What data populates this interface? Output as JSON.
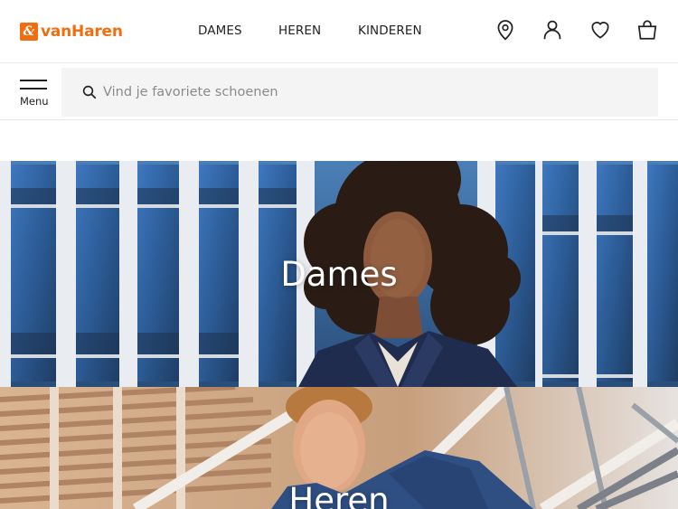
{
  "header": {
    "logo_mark": "&",
    "logo_text": "vanHaren",
    "nav": [
      {
        "label": "DAMES"
      },
      {
        "label": "HEREN"
      },
      {
        "label": "KINDEREN"
      }
    ],
    "icons": [
      "store-locator-icon",
      "account-icon",
      "wishlist-heart-icon",
      "shopping-bag-icon"
    ]
  },
  "search": {
    "menu_label": "Menu",
    "placeholder": "Vind je favoriete schoenen"
  },
  "categories": [
    {
      "title": "Dames"
    },
    {
      "title": "Heren"
    }
  ],
  "colors": {
    "brand_orange": "#f06e10"
  }
}
